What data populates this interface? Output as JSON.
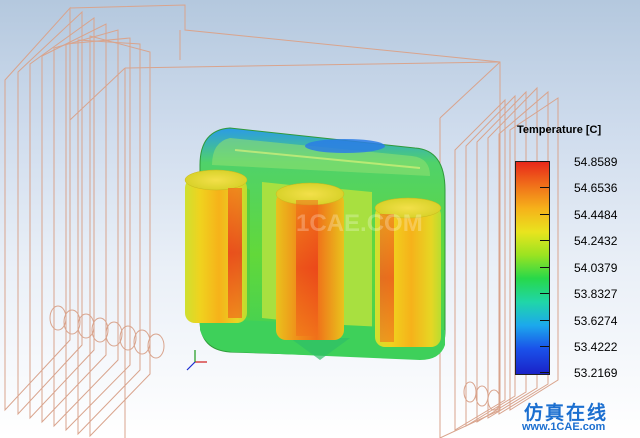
{
  "legend": {
    "title": "Temperature [C]",
    "levels": [
      "54.8589",
      "54.6536",
      "54.4484",
      "54.2432",
      "54.0379",
      "53.8327",
      "53.6274",
      "53.4222",
      "53.2169"
    ]
  },
  "colors": {
    "background_top": "#b4c8de",
    "background_bottom": "#ffffff",
    "wireframe": "#d9a48d",
    "hot": "#e8281a",
    "cold": "#1a22c8"
  },
  "watermark": {
    "text": "仿真在线",
    "url": "www.1CAE.com"
  },
  "background_mark": "1CAE.COM",
  "icons": [
    "axis-triad-icon"
  ]
}
